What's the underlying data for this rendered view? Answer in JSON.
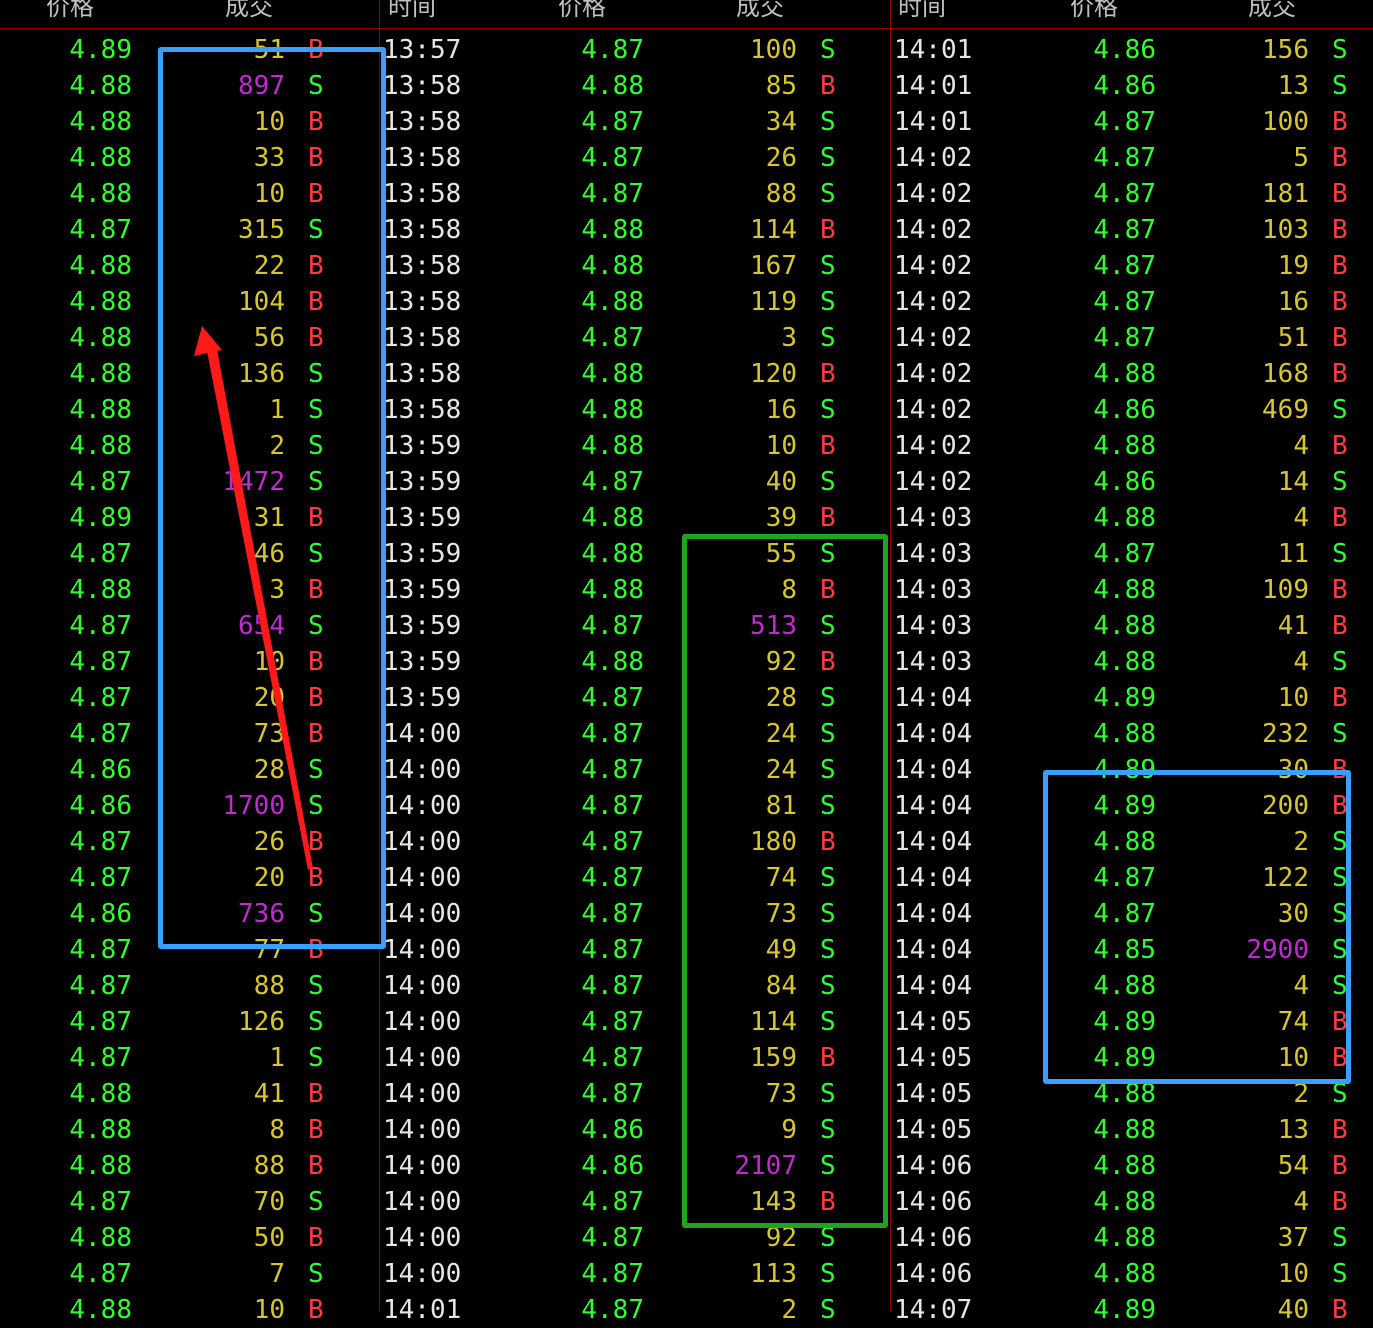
{
  "header": {
    "price_label": "价格",
    "volume_label": "成交",
    "time_label": "时间"
  },
  "colors": {
    "background": "#000000",
    "price": "#33ff33",
    "volume": "#d6c630",
    "volume_large": "#c02bd0",
    "buy": "#ff3b3b",
    "sell": "#33ff33",
    "time": "#e6e6e6",
    "divider": "#8b0000",
    "annotation_blue": "#3aa0ff",
    "annotation_green": "#21a221",
    "annotation_red": "#ff1a1a"
  },
  "panels": [
    {
      "rows": [
        {
          "time": "",
          "price": "4.89",
          "volume": "51",
          "side": "B"
        },
        {
          "time": "",
          "price": "4.88",
          "volume": "897",
          "side": "S"
        },
        {
          "time": "",
          "price": "4.88",
          "volume": "10",
          "side": "B"
        },
        {
          "time": "",
          "price": "4.88",
          "volume": "33",
          "side": "B"
        },
        {
          "time": "",
          "price": "4.88",
          "volume": "10",
          "side": "B"
        },
        {
          "time": "",
          "price": "4.87",
          "volume": "315",
          "side": "S"
        },
        {
          "time": "",
          "price": "4.88",
          "volume": "22",
          "side": "B"
        },
        {
          "time": "",
          "price": "4.88",
          "volume": "104",
          "side": "B"
        },
        {
          "time": "",
          "price": "4.88",
          "volume": "56",
          "side": "B"
        },
        {
          "time": "",
          "price": "4.88",
          "volume": "136",
          "side": "S"
        },
        {
          "time": "",
          "price": "4.88",
          "volume": "1",
          "side": "S"
        },
        {
          "time": "",
          "price": "4.88",
          "volume": "2",
          "side": "S"
        },
        {
          "time": "",
          "price": "4.87",
          "volume": "1472",
          "side": "S"
        },
        {
          "time": "",
          "price": "4.89",
          "volume": "31",
          "side": "B"
        },
        {
          "time": "",
          "price": "4.87",
          "volume": "46",
          "side": "S"
        },
        {
          "time": "",
          "price": "4.88",
          "volume": "3",
          "side": "B"
        },
        {
          "time": "",
          "price": "4.87",
          "volume": "654",
          "side": "S"
        },
        {
          "time": "",
          "price": "4.87",
          "volume": "10",
          "side": "B"
        },
        {
          "time": "",
          "price": "4.87",
          "volume": "20",
          "side": "B"
        },
        {
          "time": "",
          "price": "4.87",
          "volume": "73",
          "side": "B"
        },
        {
          "time": "",
          "price": "4.86",
          "volume": "28",
          "side": "S"
        },
        {
          "time": "",
          "price": "4.86",
          "volume": "1700",
          "side": "S"
        },
        {
          "time": "",
          "price": "4.87",
          "volume": "26",
          "side": "B"
        },
        {
          "time": "",
          "price": "4.87",
          "volume": "20",
          "side": "B"
        },
        {
          "time": "",
          "price": "4.86",
          "volume": "736",
          "side": "S"
        },
        {
          "time": "",
          "price": "4.87",
          "volume": "77",
          "side": "B"
        },
        {
          "time": "",
          "price": "4.87",
          "volume": "88",
          "side": "S"
        },
        {
          "time": "",
          "price": "4.87",
          "volume": "126",
          "side": "S"
        },
        {
          "time": "",
          "price": "4.87",
          "volume": "1",
          "side": "S"
        },
        {
          "time": "",
          "price": "4.88",
          "volume": "41",
          "side": "B"
        },
        {
          "time": "",
          "price": "4.88",
          "volume": "8",
          "side": "B"
        },
        {
          "time": "",
          "price": "4.88",
          "volume": "88",
          "side": "B"
        },
        {
          "time": "",
          "price": "4.87",
          "volume": "70",
          "side": "S"
        },
        {
          "time": "",
          "price": "4.88",
          "volume": "50",
          "side": "B"
        },
        {
          "time": "",
          "price": "4.87",
          "volume": "7",
          "side": "S"
        },
        {
          "time": "",
          "price": "4.88",
          "volume": "10",
          "side": "B"
        }
      ]
    },
    {
      "rows": [
        {
          "time": "13:57",
          "price": "4.87",
          "volume": "100",
          "side": "S"
        },
        {
          "time": "13:58",
          "price": "4.88",
          "volume": "85",
          "side": "B"
        },
        {
          "time": "13:58",
          "price": "4.87",
          "volume": "34",
          "side": "S"
        },
        {
          "time": "13:58",
          "price": "4.87",
          "volume": "26",
          "side": "S"
        },
        {
          "time": "13:58",
          "price": "4.87",
          "volume": "88",
          "side": "S"
        },
        {
          "time": "13:58",
          "price": "4.88",
          "volume": "114",
          "side": "B"
        },
        {
          "time": "13:58",
          "price": "4.88",
          "volume": "167",
          "side": "S"
        },
        {
          "time": "13:58",
          "price": "4.88",
          "volume": "119",
          "side": "S"
        },
        {
          "time": "13:58",
          "price": "4.87",
          "volume": "3",
          "side": "S"
        },
        {
          "time": "13:58",
          "price": "4.88",
          "volume": "120",
          "side": "B"
        },
        {
          "time": "13:58",
          "price": "4.88",
          "volume": "16",
          "side": "S"
        },
        {
          "time": "13:59",
          "price": "4.88",
          "volume": "10",
          "side": "B"
        },
        {
          "time": "13:59",
          "price": "4.87",
          "volume": "40",
          "side": "S"
        },
        {
          "time": "13:59",
          "price": "4.88",
          "volume": "39",
          "side": "B"
        },
        {
          "time": "13:59",
          "price": "4.88",
          "volume": "55",
          "side": "S"
        },
        {
          "time": "13:59",
          "price": "4.88",
          "volume": "8",
          "side": "B"
        },
        {
          "time": "13:59",
          "price": "4.87",
          "volume": "513",
          "side": "S"
        },
        {
          "time": "13:59",
          "price": "4.88",
          "volume": "92",
          "side": "B"
        },
        {
          "time": "13:59",
          "price": "4.87",
          "volume": "28",
          "side": "S"
        },
        {
          "time": "14:00",
          "price": "4.87",
          "volume": "24",
          "side": "S"
        },
        {
          "time": "14:00",
          "price": "4.87",
          "volume": "24",
          "side": "S"
        },
        {
          "time": "14:00",
          "price": "4.87",
          "volume": "81",
          "side": "S"
        },
        {
          "time": "14:00",
          "price": "4.87",
          "volume": "180",
          "side": "B"
        },
        {
          "time": "14:00",
          "price": "4.87",
          "volume": "74",
          "side": "S"
        },
        {
          "time": "14:00",
          "price": "4.87",
          "volume": "73",
          "side": "S"
        },
        {
          "time": "14:00",
          "price": "4.87",
          "volume": "49",
          "side": "S"
        },
        {
          "time": "14:00",
          "price": "4.87",
          "volume": "84",
          "side": "S"
        },
        {
          "time": "14:00",
          "price": "4.87",
          "volume": "114",
          "side": "S"
        },
        {
          "time": "14:00",
          "price": "4.87",
          "volume": "159",
          "side": "B"
        },
        {
          "time": "14:00",
          "price": "4.87",
          "volume": "73",
          "side": "S"
        },
        {
          "time": "14:00",
          "price": "4.86",
          "volume": "9",
          "side": "S"
        },
        {
          "time": "14:00",
          "price": "4.86",
          "volume": "2107",
          "side": "S"
        },
        {
          "time": "14:00",
          "price": "4.87",
          "volume": "143",
          "side": "B"
        },
        {
          "time": "14:00",
          "price": "4.87",
          "volume": "92",
          "side": "S"
        },
        {
          "time": "14:00",
          "price": "4.87",
          "volume": "113",
          "side": "S"
        },
        {
          "time": "14:01",
          "price": "4.87",
          "volume": "2",
          "side": "S"
        }
      ]
    },
    {
      "rows": [
        {
          "time": "14:01",
          "price": "4.86",
          "volume": "156",
          "side": "S"
        },
        {
          "time": "14:01",
          "price": "4.86",
          "volume": "13",
          "side": "S"
        },
        {
          "time": "14:01",
          "price": "4.87",
          "volume": "100",
          "side": "B"
        },
        {
          "time": "14:02",
          "price": "4.87",
          "volume": "5",
          "side": "B"
        },
        {
          "time": "14:02",
          "price": "4.87",
          "volume": "181",
          "side": "B"
        },
        {
          "time": "14:02",
          "price": "4.87",
          "volume": "103",
          "side": "B"
        },
        {
          "time": "14:02",
          "price": "4.87",
          "volume": "19",
          "side": "B"
        },
        {
          "time": "14:02",
          "price": "4.87",
          "volume": "16",
          "side": "B"
        },
        {
          "time": "14:02",
          "price": "4.87",
          "volume": "51",
          "side": "B"
        },
        {
          "time": "14:02",
          "price": "4.88",
          "volume": "168",
          "side": "B"
        },
        {
          "time": "14:02",
          "price": "4.86",
          "volume": "469",
          "side": "S"
        },
        {
          "time": "14:02",
          "price": "4.88",
          "volume": "4",
          "side": "B"
        },
        {
          "time": "14:02",
          "price": "4.86",
          "volume": "14",
          "side": "S"
        },
        {
          "time": "14:03",
          "price": "4.88",
          "volume": "4",
          "side": "B"
        },
        {
          "time": "14:03",
          "price": "4.87",
          "volume": "11",
          "side": "S"
        },
        {
          "time": "14:03",
          "price": "4.88",
          "volume": "109",
          "side": "B"
        },
        {
          "time": "14:03",
          "price": "4.88",
          "volume": "41",
          "side": "B"
        },
        {
          "time": "14:03",
          "price": "4.88",
          "volume": "4",
          "side": "S"
        },
        {
          "time": "14:04",
          "price": "4.89",
          "volume": "10",
          "side": "B"
        },
        {
          "time": "14:04",
          "price": "4.88",
          "volume": "232",
          "side": "S"
        },
        {
          "time": "14:04",
          "price": "4.89",
          "volume": "30",
          "side": "B"
        },
        {
          "time": "14:04",
          "price": "4.89",
          "volume": "200",
          "side": "B"
        },
        {
          "time": "14:04",
          "price": "4.88",
          "volume": "2",
          "side": "S"
        },
        {
          "time": "14:04",
          "price": "4.87",
          "volume": "122",
          "side": "S"
        },
        {
          "time": "14:04",
          "price": "4.87",
          "volume": "30",
          "side": "S"
        },
        {
          "time": "14:04",
          "price": "4.85",
          "volume": "2900",
          "side": "S"
        },
        {
          "time": "14:04",
          "price": "4.88",
          "volume": "4",
          "side": "S"
        },
        {
          "time": "14:05",
          "price": "4.89",
          "volume": "74",
          "side": "B"
        },
        {
          "time": "14:05",
          "price": "4.89",
          "volume": "10",
          "side": "B"
        },
        {
          "time": "14:05",
          "price": "4.88",
          "volume": "2",
          "side": "S"
        },
        {
          "time": "14:05",
          "price": "4.88",
          "volume": "13",
          "side": "B"
        },
        {
          "time": "14:06",
          "price": "4.88",
          "volume": "54",
          "side": "B"
        },
        {
          "time": "14:06",
          "price": "4.88",
          "volume": "4",
          "side": "B"
        },
        {
          "time": "14:06",
          "price": "4.88",
          "volume": "37",
          "side": "S"
        },
        {
          "time": "14:06",
          "price": "4.88",
          "volume": "10",
          "side": "S"
        },
        {
          "time": "14:07",
          "price": "4.89",
          "volume": "40",
          "side": "B"
        }
      ]
    }
  ]
}
